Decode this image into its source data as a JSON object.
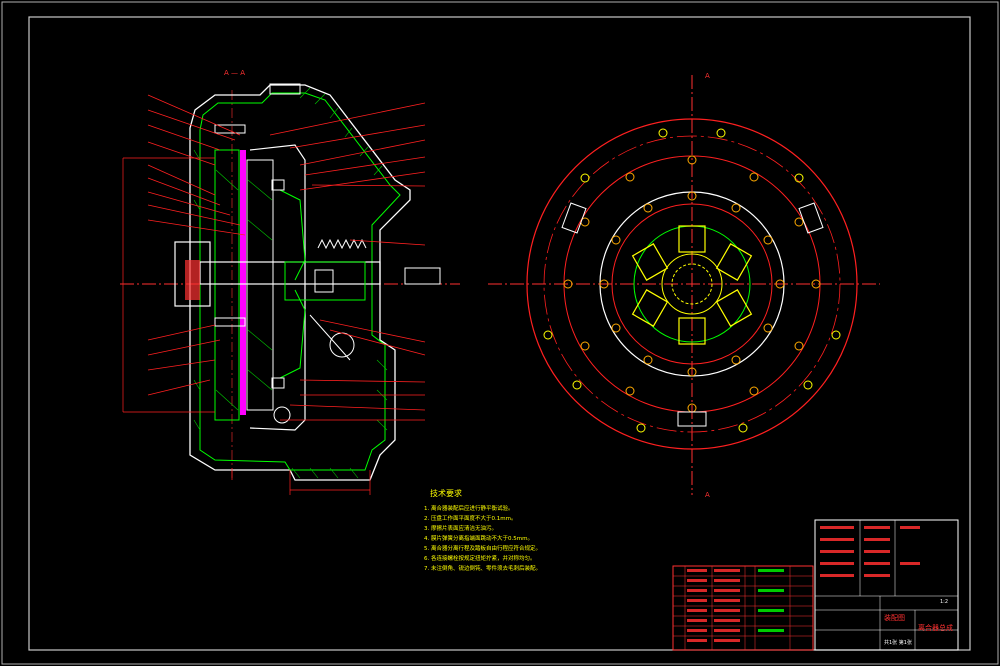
{
  "section_label": "A — A",
  "section_marker_top": "A",
  "section_marker_bottom": "A",
  "notes": {
    "title": "技术要求",
    "items": [
      "1. 离合器装配后应进行静平衡试验。",
      "2. 压盘工作面平面度不大于0.1mm。",
      "3. 摩擦片表面应清洁无油污。",
      "4. 膜片弹簧分离指端面跳动不大于0.5mm。",
      "5. 离合器分离行程及踏板自由行程应符合规定。",
      "6. 各连接螺栓按规定扭矩拧紧，并对称均匀。",
      "7. 未注倒角、锐边倒钝、零件须去毛刺后装配。"
    ]
  },
  "title_block": {
    "drawing_name": "离合器总成",
    "drawing_type": "装配图",
    "scale": "1:2",
    "sheet": "共1张 第1张"
  },
  "colors": {
    "background": "#000000",
    "frame": "#c8c8c8",
    "main_lines": "#ffffff",
    "hatch": "#00ff00",
    "section_red": "#ff2020",
    "centerline": "#ff3030",
    "friction": "#ff00ff",
    "notes": "#ffff00",
    "table_green": "#00ff00"
  }
}
